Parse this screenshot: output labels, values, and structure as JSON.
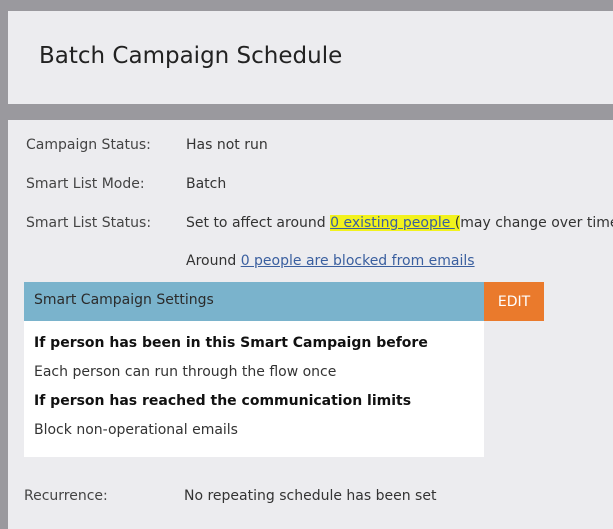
{
  "header": {
    "title": "Batch Campaign Schedule"
  },
  "details": {
    "campaign_status_label": "Campaign Status:",
    "campaign_status_value": "Has not run",
    "smart_list_mode_label": "Smart List Mode:",
    "smart_list_mode_value": "Batch",
    "smart_list_status_label": "Smart List Status:",
    "smart_list_status_prefix": "Set to affect around ",
    "smart_list_status_link": "0 existing people ",
    "smart_list_status_paren": "(",
    "smart_list_status_suffix": "may change over time)",
    "blocked_prefix": "Around ",
    "blocked_link": "0 people are blocked from emails"
  },
  "settings": {
    "title": "Smart Campaign Settings",
    "edit_label": "EDIT",
    "line1": "If person has been in this Smart Campaign before",
    "line2": "Each person can run through the flow once",
    "line3": "If person has reached the communication limits",
    "line4": "Block non-operational emails"
  },
  "recurrence": {
    "label": "Recurrence:",
    "value": "No repeating schedule has been set"
  },
  "colors": {
    "settings_bar": "#7ab3cc",
    "edit_button": "#ea7a2c",
    "highlight": "#f2f21d",
    "link": "#3a5f9f"
  }
}
